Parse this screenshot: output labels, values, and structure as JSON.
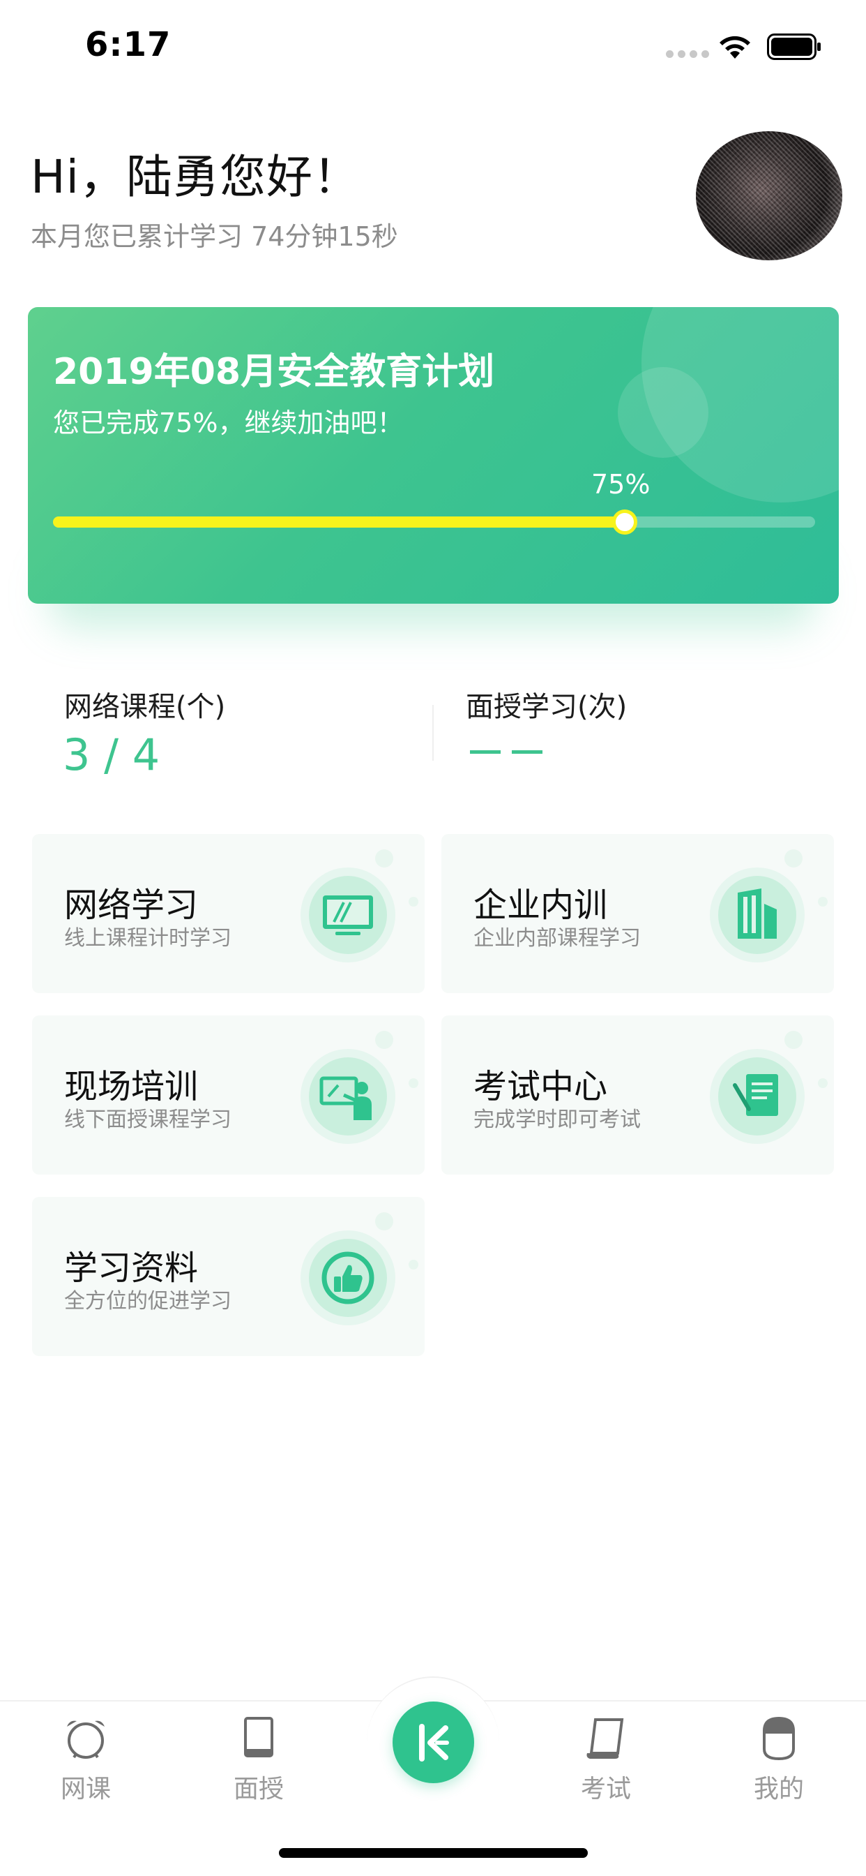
{
  "status_bar": {
    "time": "6:17"
  },
  "header": {
    "greeting": "Hi，陆勇您好！",
    "study_summary": "本月您已累计学习 74分钟15秒"
  },
  "plan": {
    "title": "2019年08月安全教育计划",
    "subtitle": "您已完成75%，继续加油吧！",
    "percent_label": "75%",
    "progress_fraction": 0.75,
    "colors": {
      "card": "#3ec48f",
      "progress": "#f7f31c"
    }
  },
  "stats": {
    "online": {
      "label": "网络课程(个)",
      "value": "3 / 4"
    },
    "offline": {
      "label": "面授学习(次)",
      "value": "— —"
    }
  },
  "tiles": [
    {
      "title": "网络学习",
      "subtitle": "线上课程计时学习",
      "icon": "monitor-icon"
    },
    {
      "title": "企业内训",
      "subtitle": "企业内部课程学习",
      "icon": "building-icon"
    },
    {
      "title": "现场培训",
      "subtitle": "线下面授课程学习",
      "icon": "teacher-board-icon"
    },
    {
      "title": "考试中心",
      "subtitle": "完成学时即可考试",
      "icon": "exam-paper-icon"
    },
    {
      "title": "学习资料",
      "subtitle": "全方位的促进学习",
      "icon": "thumbs-up-icon"
    }
  ],
  "tabbar": {
    "items": [
      {
        "label": "网课",
        "icon": "alarm-clock-icon"
      },
      {
        "label": "面授",
        "icon": "book-icon"
      },
      {
        "label": "",
        "icon": "home-logo-icon"
      },
      {
        "label": "考试",
        "icon": "scroll-icon"
      },
      {
        "label": "我的",
        "icon": "profile-icon"
      }
    ],
    "accent": "#2fc38e"
  }
}
